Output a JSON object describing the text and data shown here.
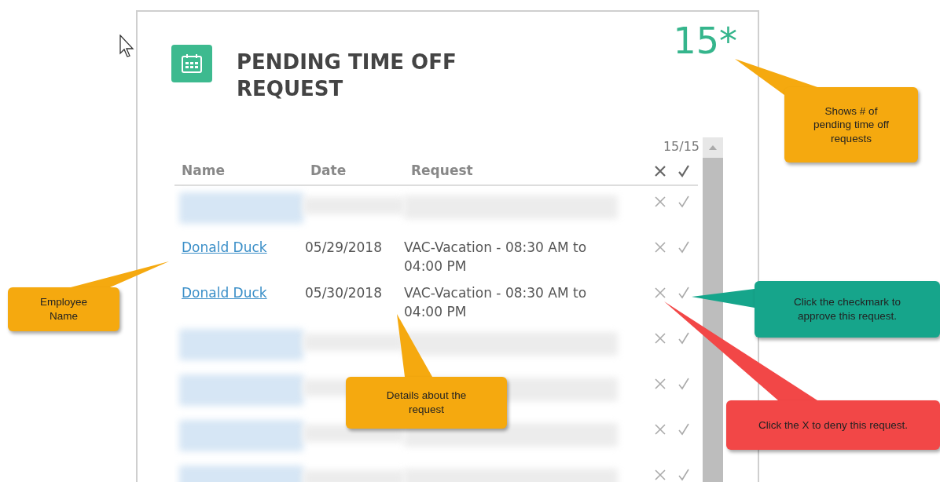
{
  "widget": {
    "title": "PENDING TIME OFF REQUEST",
    "count": "15*",
    "pager": "15/15",
    "columns": [
      "Name",
      "Date",
      "Request"
    ],
    "rows": [
      {
        "kind": "redacted"
      },
      {
        "kind": "entry",
        "name": "Donald Duck",
        "date": "05/29/2018",
        "request": "VAC-Vacation - 08:30 AM to 04:00 PM"
      },
      {
        "kind": "entry",
        "name": "Donald Duck",
        "date": "05/30/2018",
        "request": "VAC-Vacation - 08:30 AM to 04:00 PM"
      },
      {
        "kind": "redacted"
      },
      {
        "kind": "redacted"
      },
      {
        "kind": "redacted"
      },
      {
        "kind": "redacted"
      }
    ]
  },
  "callouts": [
    {
      "text": "Shows # of pending time off requests",
      "color": "#f5a90f"
    },
    {
      "text": "Employee Name",
      "color": "#f5a90f"
    },
    {
      "text": "Details about the request",
      "color": "#f5a90f"
    },
    {
      "text": "Click the checkmark to approve this request.",
      "color": "#16a58b"
    },
    {
      "text": "Click the X to deny this request.",
      "color": "#f24747"
    }
  ]
}
